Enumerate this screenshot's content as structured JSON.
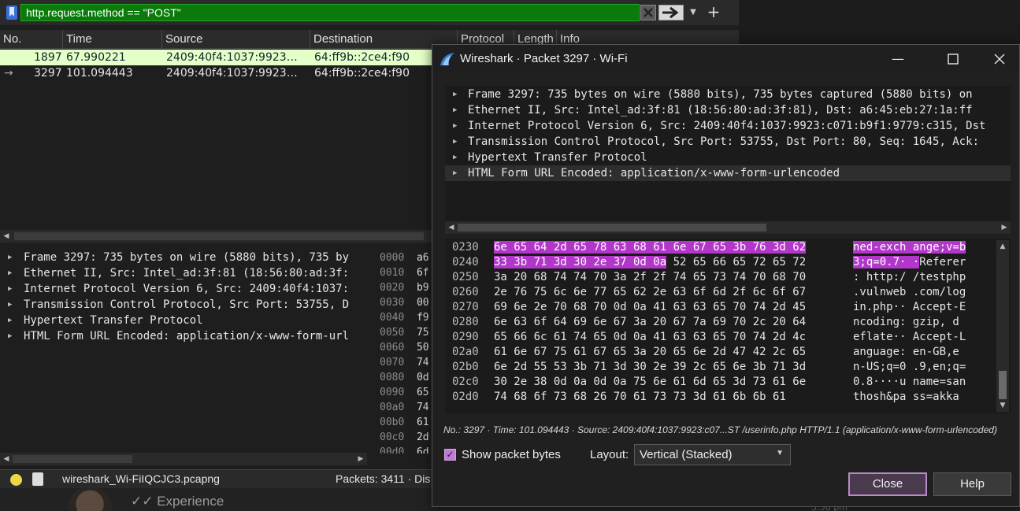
{
  "filter": {
    "value": "http.request.method == \"POST\""
  },
  "columns": [
    "No.",
    "Time",
    "Source",
    "Destination",
    "Protocol",
    "Length",
    "Info"
  ],
  "packets": [
    {
      "no": "1897",
      "time": "67.990221",
      "source": "2409:40f4:1037:9923…",
      "destination": "64:ff9b::2ce4:f90"
    },
    {
      "no": "3297",
      "time": "101.094443",
      "source": "2409:40f4:1037:9923…",
      "destination": "64:ff9b::2ce4:f90"
    }
  ],
  "details": [
    "Frame 3297: 735 bytes on wire (5880 bits), 735 by",
    "Ethernet II, Src: Intel_ad:3f:81 (18:56:80:ad:3f:",
    "Internet Protocol Version 6, Src: 2409:40f4:1037:",
    "Transmission Control Protocol, Src Port: 53755, D",
    "Hypertext Transfer Protocol",
    "HTML Form URL Encoded: application/x-www-form-url"
  ],
  "bytes_offsets": [
    "0000",
    "0010",
    "0020",
    "0030",
    "0040",
    "0050",
    "0060",
    "0070",
    "0080",
    "0090",
    "00a0",
    "00b0",
    "00c0",
    "00d0"
  ],
  "bytes_peek": [
    "a6",
    "6f",
    "b9",
    "00",
    "f9",
    "75",
    "50",
    "74",
    "0d",
    "65",
    "74",
    "61",
    "2d",
    "6d"
  ],
  "status": {
    "file": "wireshark_Wi-FiIQCJC3.pcapng",
    "packets": "Packets: 3411 · Dis"
  },
  "dialog": {
    "title": "Wireshark · Packet 3297 · Wi-Fi",
    "tree": [
      "Frame 3297: 735 bytes on wire (5880 bits), 735 bytes captured (5880 bits) on",
      "Ethernet II, Src: Intel_ad:3f:81 (18:56:80:ad:3f:81), Dst: a6:45:eb:27:1a:ff",
      "Internet Protocol Version 6, Src: 2409:40f4:1037:9923:c071:b9f1:9779:c315, Dst",
      "Transmission Control Protocol, Src Port: 53755, Dst Port: 80, Seq: 1645, Ack:",
      "Hypertext Transfer Protocol",
      "HTML Form URL Encoded: application/x-www-form-urlencoded"
    ],
    "hex_rows": [
      {
        "offset": "0230",
        "hex_hl": "6e 65 64 2d 65 78 63 68  61 6e 67 65 3b 76 3d 62",
        "hex_rest": "",
        "ascii_hl": "ned-exch ange;v=b",
        "ascii_rest": ""
      },
      {
        "offset": "0240",
        "hex_hl": "33 3b 71 3d 30 2e 37 0d  0a",
        "hex_rest": " 52 65 66 65 72 65 72",
        "ascii_hl": "3;q=0.7· ·",
        "ascii_rest": "Referer"
      },
      {
        "offset": "0250",
        "hex_hl": "",
        "hex_rest": "3a 20 68 74 74 70 3a 2f  2f 74 65 73 74 70 68 70",
        "ascii_hl": "",
        "ascii_rest": ": http:/ /testphp"
      },
      {
        "offset": "0260",
        "hex_hl": "",
        "hex_rest": "2e 76 75 6c 6e 77 65 62  2e 63 6f 6d 2f 6c 6f 67",
        "ascii_hl": "",
        "ascii_rest": ".vulnweb .com/log"
      },
      {
        "offset": "0270",
        "hex_hl": "",
        "hex_rest": "69 6e 2e 70 68 70 0d 0a  41 63 63 65 70 74 2d 45",
        "ascii_hl": "",
        "ascii_rest": "in.php·· Accept-E"
      },
      {
        "offset": "0280",
        "hex_hl": "",
        "hex_rest": "6e 63 6f 64 69 6e 67 3a  20 67 7a 69 70 2c 20 64",
        "ascii_hl": "",
        "ascii_rest": "ncoding:  gzip, d"
      },
      {
        "offset": "0290",
        "hex_hl": "",
        "hex_rest": "65 66 6c 61 74 65 0d 0a  41 63 63 65 70 74 2d 4c",
        "ascii_hl": "",
        "ascii_rest": "eflate·· Accept-L"
      },
      {
        "offset": "02a0",
        "hex_hl": "",
        "hex_rest": "61 6e 67 75 61 67 65 3a  20 65 6e 2d 47 42 2c 65",
        "ascii_hl": "",
        "ascii_rest": "anguage:  en-GB,e"
      },
      {
        "offset": "02b0",
        "hex_hl": "",
        "hex_rest": "6e 2d 55 53 3b 71 3d 30  2e 39 2c 65 6e 3b 71 3d",
        "ascii_hl": "",
        "ascii_rest": "n-US;q=0 .9,en;q="
      },
      {
        "offset": "02c0",
        "hex_hl": "",
        "hex_rest": "30 2e 38 0d 0a 0d 0a 75  6e 61 6d 65 3d 73 61 6e",
        "ascii_hl": "",
        "ascii_rest": "0.8····u name=san"
      },
      {
        "offset": "02d0",
        "hex_hl": "",
        "hex_rest": "74 68 6f 73 68 26 70 61  73 73 3d 61 6b 6b 61",
        "ascii_hl": "",
        "ascii_rest": "thosh&pa ss=akka"
      }
    ],
    "info": "No.: 3297 · Time: 101.094443 · Source: 2409:40f4:1037:9923:c07...ST /userinfo.php HTTP/1.1 (application/x-www-form-urlencoded)",
    "show_bytes_label": "Show packet bytes",
    "show_bytes_checked": true,
    "layout_label": "Layout:",
    "layout_value": "Vertical (Stacked)",
    "close_label": "Close",
    "help_label": "Help"
  },
  "background": {
    "experience": "Experience",
    "time": "5:50 pm"
  },
  "colors": {
    "filter_ok": "#0a7a0a",
    "row_highlight": "#e4ffc7",
    "byte_highlight": "#b236c9"
  }
}
